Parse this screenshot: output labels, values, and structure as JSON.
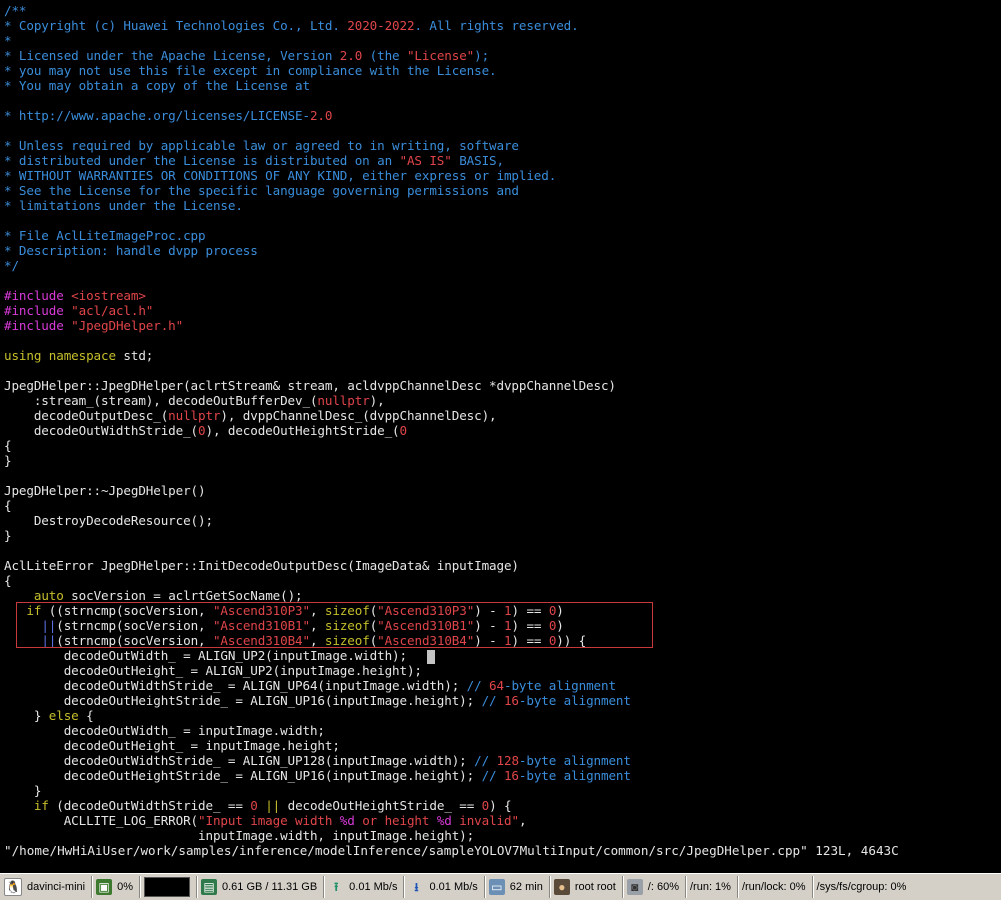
{
  "editor": {
    "code_lines": [
      [
        [
          "/**",
          "c"
        ]
      ],
      [
        [
          "* Copyright (c) Huawei Technologies Co., Ltd. ",
          "c"
        ],
        [
          "2020-2022",
          "r"
        ],
        [
          ". All rights reserved.",
          "c"
        ]
      ],
      [
        [
          "*",
          "c"
        ]
      ],
      [
        [
          "* Licensed under the Apache License, Version ",
          "c"
        ],
        [
          "2.0",
          "r"
        ],
        [
          " (the ",
          "c"
        ],
        [
          "\"License\"",
          "r"
        ],
        [
          ");",
          "c"
        ]
      ],
      [
        [
          "* you may not use this file except in compliance with the License.",
          "c"
        ]
      ],
      [
        [
          "* You may obtain a copy of the License at",
          "c"
        ]
      ],
      [
        [
          "",
          "n"
        ]
      ],
      [
        [
          "* http://www.apache.org/licenses/LICENSE-",
          "c"
        ],
        [
          "2.0",
          "r"
        ]
      ],
      [
        [
          "",
          "n"
        ]
      ],
      [
        [
          "* Unless required by applicable law or agreed to in writing, software",
          "c"
        ]
      ],
      [
        [
          "* distributed under the License is distributed on an ",
          "c"
        ],
        [
          "\"AS IS\"",
          "r"
        ],
        [
          " BASIS,",
          "c"
        ]
      ],
      [
        [
          "* WITHOUT WARRANTIES OR CONDITIONS OF ANY KIND, either express or implied.",
          "c"
        ]
      ],
      [
        [
          "* See the License for the specific language governing permissions and",
          "c"
        ]
      ],
      [
        [
          "* limitations under the License.",
          "c"
        ]
      ],
      [
        [
          "",
          "n"
        ]
      ],
      [
        [
          "* File AclLiteImageProc.cpp",
          "c"
        ]
      ],
      [
        [
          "* Description: handle dvpp process",
          "c"
        ]
      ],
      [
        [
          "*/",
          "c"
        ]
      ],
      [
        [
          "",
          "n"
        ]
      ],
      [
        [
          "#include ",
          "p"
        ],
        [
          "<iostream>",
          "s"
        ]
      ],
      [
        [
          "#include ",
          "p"
        ],
        [
          "\"acl/acl.h\"",
          "s"
        ]
      ],
      [
        [
          "#include ",
          "p"
        ],
        [
          "\"JpegDHelper.h\"",
          "s"
        ]
      ],
      [
        [
          "",
          "n"
        ]
      ],
      [
        [
          "using",
          "k"
        ],
        [
          " ",
          "n"
        ],
        [
          "namespace",
          "k"
        ],
        [
          " std;",
          "n"
        ]
      ],
      [
        [
          "",
          "n"
        ]
      ],
      [
        [
          "JpegDHelper::JpegDHelper(aclrtStream& stream, acldvppChannelDesc *dvppChannelDesc)",
          "n"
        ]
      ],
      [
        [
          "    :stream_(stream), decodeOutBufferDev_(",
          "n"
        ],
        [
          "nullptr",
          "r"
        ],
        [
          "),",
          "n"
        ]
      ],
      [
        [
          "    decodeOutputDesc_(",
          "n"
        ],
        [
          "nullptr",
          "r"
        ],
        [
          "), dvppChannelDesc_(dvppChannelDesc),",
          "n"
        ]
      ],
      [
        [
          "    decodeOutWidthStride_(",
          "n"
        ],
        [
          "0",
          "r"
        ],
        [
          "), decodeOutHeightStride_(",
          "n"
        ],
        [
          "0",
          "r"
        ]
      ],
      [
        [
          "{",
          "n"
        ]
      ],
      [
        [
          "}",
          "n"
        ]
      ],
      [
        [
          "",
          "n"
        ]
      ],
      [
        [
          "JpegDHelper::~JpegDHelper()",
          "n"
        ]
      ],
      [
        [
          "{",
          "n"
        ]
      ],
      [
        [
          "    DestroyDecodeResource();",
          "n"
        ]
      ],
      [
        [
          "}",
          "n"
        ]
      ],
      [
        [
          "",
          "n"
        ]
      ],
      [
        [
          "AclLiteError JpegDHelper::InitDecodeOutputDesc(ImageData& inputImage)",
          "n"
        ]
      ],
      [
        [
          "{",
          "n"
        ]
      ],
      [
        [
          "    ",
          "n"
        ],
        [
          "auto",
          "k"
        ],
        [
          " socVersion = aclrtGetSocName();",
          "n"
        ]
      ],
      [
        [
          "   ",
          "n"
        ],
        [
          "if",
          "k"
        ],
        [
          " ((strncmp(socVersion, ",
          "n"
        ],
        [
          "\"Ascend310P3\"",
          "s"
        ],
        [
          ", ",
          "n"
        ],
        [
          "sizeof",
          "k"
        ],
        [
          "(",
          "n"
        ],
        [
          "\"Ascend310P3\"",
          "s"
        ],
        [
          ") - ",
          "n"
        ],
        [
          "1",
          "r"
        ],
        [
          ") == ",
          "n"
        ],
        [
          "0",
          "r"
        ],
        [
          ")",
          "n"
        ]
      ],
      [
        [
          "     ",
          "n"
        ],
        [
          "||",
          "o"
        ],
        [
          "(strncmp(socVersion, ",
          "n"
        ],
        [
          "\"Ascend310B1\"",
          "s"
        ],
        [
          ", ",
          "n"
        ],
        [
          "sizeof",
          "k"
        ],
        [
          "(",
          "n"
        ],
        [
          "\"Ascend310B1\"",
          "s"
        ],
        [
          ") - ",
          "n"
        ],
        [
          "1",
          "r"
        ],
        [
          ") == ",
          "n"
        ],
        [
          "0",
          "r"
        ],
        [
          ")",
          "n"
        ]
      ],
      [
        [
          "     ",
          "n"
        ],
        [
          "||",
          "o"
        ],
        [
          "(strncmp(socVersion, ",
          "n"
        ],
        [
          "\"Ascend310B4\"",
          "s"
        ],
        [
          ", ",
          "n"
        ],
        [
          "sizeof",
          "k"
        ],
        [
          "(",
          "n"
        ],
        [
          "\"Ascend310B4\"",
          "s"
        ],
        [
          ") - ",
          "n"
        ],
        [
          "1",
          "r"
        ],
        [
          ") == ",
          "n"
        ],
        [
          "0",
          "r"
        ],
        [
          ")) {",
          "n"
        ]
      ],
      [
        [
          "        decodeOutWidth_ = ALIGN_UP2(inputImage.width);",
          "n"
        ]
      ],
      [
        [
          "        decodeOutHeight_ = ALIGN_UP2(inputImage.height);",
          "n"
        ]
      ],
      [
        [
          "        decodeOutWidthStride_ = ALIGN_UP64(inputImage.width); ",
          "n"
        ],
        [
          "// ",
          "c"
        ],
        [
          "64",
          "r"
        ],
        [
          "-byte alignment",
          "c"
        ]
      ],
      [
        [
          "        decodeOutHeightStride_ = ALIGN_UP16(inputImage.height); ",
          "n"
        ],
        [
          "// ",
          "c"
        ],
        [
          "16",
          "r"
        ],
        [
          "-byte alignment",
          "c"
        ]
      ],
      [
        [
          "    } ",
          "n"
        ],
        [
          "else",
          "k"
        ],
        [
          " {",
          "n"
        ]
      ],
      [
        [
          "        decodeOutWidth_ = inputImage.width;",
          "n"
        ]
      ],
      [
        [
          "        decodeOutHeight_ = inputImage.height;",
          "n"
        ]
      ],
      [
        [
          "        decodeOutWidthStride_ = ALIGN_UP128(inputImage.width); ",
          "n"
        ],
        [
          "// ",
          "c"
        ],
        [
          "128",
          "r"
        ],
        [
          "-byte alignment",
          "c"
        ]
      ],
      [
        [
          "        decodeOutHeightStride_ = ALIGN_UP16(inputImage.height); ",
          "n"
        ],
        [
          "// ",
          "c"
        ],
        [
          "16",
          "r"
        ],
        [
          "-byte alignment",
          "c"
        ]
      ],
      [
        [
          "    }",
          "n"
        ]
      ],
      [
        [
          "    ",
          "n"
        ],
        [
          "if",
          "k"
        ],
        [
          " (decodeOutWidthStride_ == ",
          "n"
        ],
        [
          "0",
          "r"
        ],
        [
          " ",
          "n"
        ],
        [
          "||",
          "k"
        ],
        [
          " decodeOutHeightStride_ == ",
          "n"
        ],
        [
          "0",
          "r"
        ],
        [
          ") {",
          "n"
        ]
      ],
      [
        [
          "        ACLLITE_LOG_ERROR(",
          "n"
        ],
        [
          "\"Input image width ",
          "s"
        ],
        [
          "%d",
          "p"
        ],
        [
          " or height ",
          "s"
        ],
        [
          "%d",
          "p"
        ],
        [
          " invalid\"",
          "s"
        ],
        [
          ",",
          "n"
        ]
      ],
      [
        [
          "                          inputImage.width, inputImage.height);",
          "n"
        ]
      ]
    ],
    "status_line": "\"/home/HwHiAiUser/work/samples/inference/modelInference/sampleYOLOV7MultiInput/common/src/JpegDHelper.cpp\" 123L, 4643C"
  },
  "taskbar": {
    "host": "davinci-mini",
    "cpu": "0%",
    "memory": "0.61 GB / 11.31 GB",
    "upload": "0.01 Mb/s",
    "download": "0.01 Mb/s",
    "uptime": "62 min",
    "user": "root root",
    "disk_root": "/: 60%",
    "disk_run": "/run: 1%",
    "disk_run_lock": "/run/lock: 0%",
    "disk_cgroup": "/sys/fs/cgroup: 0%"
  },
  "colors": {
    "comment": "#3a8ddb",
    "literal": "#e0454a",
    "preprocessor": "#d83ad8",
    "keyword": "#c6bf2b",
    "highlight_box": "#c8393c"
  }
}
